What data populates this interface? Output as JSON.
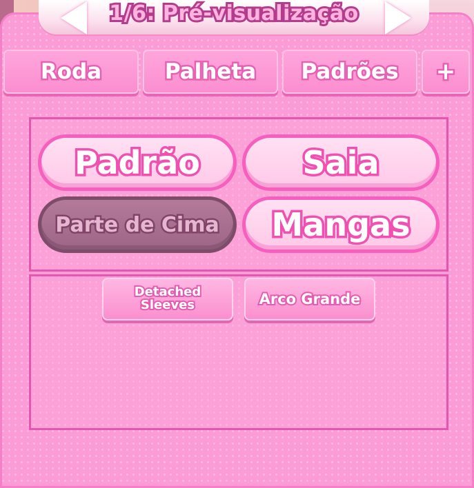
{
  "header": {
    "title": "1/6: Pré-visualização",
    "prev_icon": "arrow-left-icon",
    "next_icon": "arrow-right-icon"
  },
  "tabs": [
    {
      "label": "Roda"
    },
    {
      "label": "Palheta"
    },
    {
      "label": "Padrões"
    },
    {
      "label": "+"
    }
  ],
  "categories": [
    {
      "label": "Padrão",
      "state": "normal"
    },
    {
      "label": "Saia",
      "state": "normal"
    },
    {
      "label": "Parte de Cima",
      "state": "selected"
    },
    {
      "label": "Mangas",
      "state": "normal"
    }
  ],
  "items": [
    {
      "label_line1": "Detached",
      "label_line2": "Sleeves"
    },
    {
      "label": "Arco Grande"
    }
  ],
  "colors": {
    "panel": "#fb9cd6",
    "border": "#e357b0",
    "selected": "#9e6686"
  }
}
